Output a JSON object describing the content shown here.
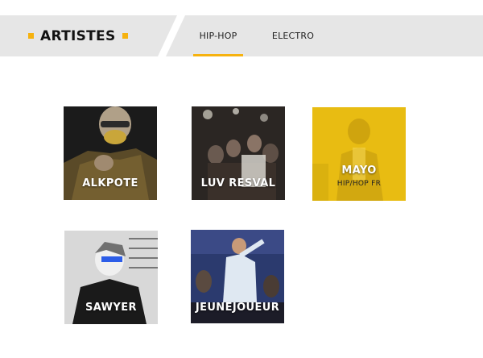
{
  "header": {
    "title": "ARTISTES",
    "tabs": [
      {
        "label": "HIP-HOP",
        "active": true
      },
      {
        "label": "ELECTRO",
        "active": false
      }
    ]
  },
  "colors": {
    "accent": "#f6b20f",
    "header_bg": "#e6e6e6",
    "highlight_overlay": "#e8bc12"
  },
  "artists": [
    {
      "name": "ALKPOTE",
      "genre": ""
    },
    {
      "name": "LUV RESVAL",
      "genre": ""
    },
    {
      "name": "MAYO",
      "genre": "HIP/HOP FR",
      "highlighted": true
    },
    {
      "name": "SAWYER",
      "genre": ""
    },
    {
      "name": "JEUNEJOUEUR",
      "genre": ""
    }
  ]
}
